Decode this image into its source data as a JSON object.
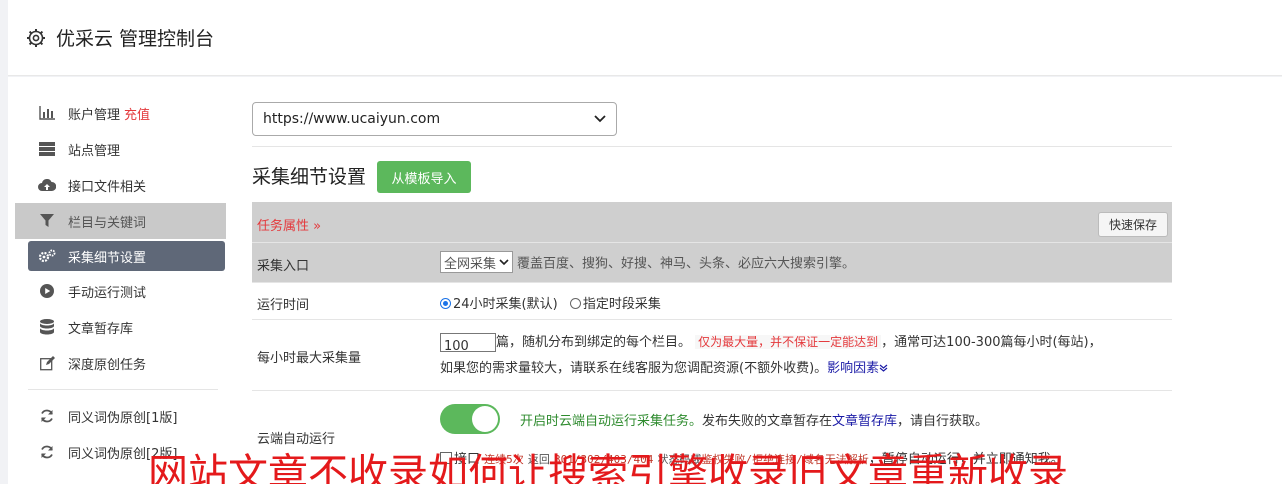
{
  "header": {
    "title": "优采云 管理控制台"
  },
  "sidebar": {
    "items": [
      {
        "label": "账户管理",
        "badge": "充值",
        "icon": "bar-chart-icon"
      },
      {
        "label": "站点管理",
        "icon": "server-icon"
      },
      {
        "label": "接口文件相关",
        "icon": "cloud-upload-icon"
      },
      {
        "label": "栏目与关键词",
        "icon": "filter-icon"
      },
      {
        "label": "采集细节设置",
        "icon": "gears-icon"
      },
      {
        "label": "手动运行测试",
        "icon": "play-circle-icon"
      },
      {
        "label": "文章暂存库",
        "icon": "database-icon"
      },
      {
        "label": "深度原创任务",
        "icon": "edit-icon"
      },
      {
        "label": "同义词伪原创[1版]",
        "icon": "refresh-icon"
      },
      {
        "label": "同义词伪原创[2版]",
        "icon": "refresh-icon"
      }
    ]
  },
  "site_select": {
    "value": "https://www.ucaiyun.com"
  },
  "section": {
    "title": "采集细节设置",
    "import_label": "从模板导入"
  },
  "table": {
    "task_attr": "任务属性 »",
    "quick_save": "快速保存",
    "entry": {
      "label": "采集入口",
      "select": "全网采集",
      "desc": "覆盖百度、搜狗、好搜、神马、头条、必应六大搜索引擎。"
    },
    "time": {
      "label": "运行时间",
      "opt1": "24小时采集(默认)",
      "opt2": "指定时段采集"
    },
    "max": {
      "label": "每小时最大采集量",
      "value": "100",
      "text1": "篇，随机分布到绑定的每个栏目。",
      "warn": "仅为最大量，并不保证一定能达到",
      "text2": "，通常可达100-300篇每小时(每站)，",
      "text3": "如果您的需求量较大，请联系在线客服为您调配资源(不额外收费)。",
      "link": "影响因素"
    },
    "cloud": {
      "label": "云端自动运行",
      "green": "开启时云端自动运行采集任务。",
      "text1": "发布失败的文章暂存在",
      "link": "文章暂存库",
      "text2": "，请自行获取。",
      "cb_label": "接口",
      "red1": "连续5次",
      "t_ret": "返回",
      "red2": "301/302/403/404",
      "t_code": "状态码或",
      "red3": "鉴权失败/拒绝连接/域名无法解析",
      "text3": "，暂停自动运行，并立即通知我。"
    }
  },
  "overlay_text": "网站文章不收录如何让搜索引擎收录旧文章重新收录"
}
